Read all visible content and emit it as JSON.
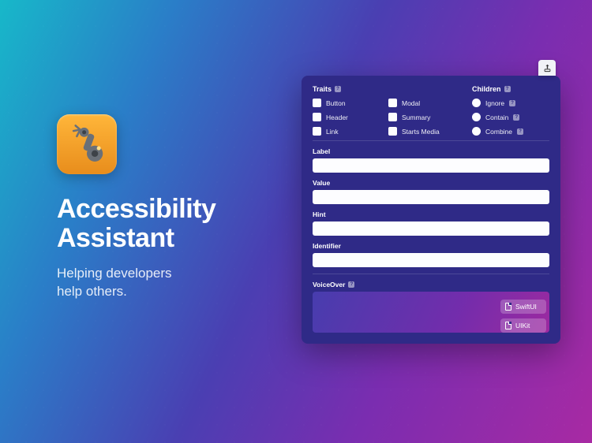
{
  "left": {
    "title_line1": "Accessibility",
    "title_line2": "Assistant",
    "subtitle_line1": "Helping developers",
    "subtitle_line2": "help others."
  },
  "panel": {
    "traits": {
      "heading": "Traits",
      "items": [
        {
          "label": "Button"
        },
        {
          "label": "Modal"
        },
        {
          "label": "Header"
        },
        {
          "label": "Summary"
        },
        {
          "label": "Link"
        },
        {
          "label": "Starts Media"
        }
      ]
    },
    "children": {
      "heading": "Children",
      "options": [
        {
          "label": "Ignore"
        },
        {
          "label": "Contain"
        },
        {
          "label": "Combine"
        }
      ]
    },
    "fields": {
      "label": "Label",
      "value": "Value",
      "hint": "Hint",
      "identifier": "Identifier"
    },
    "voiceover": {
      "heading": "VoiceOver",
      "buttons": {
        "swiftui": "SwiftUI",
        "uikit": "UIKit"
      }
    }
  }
}
